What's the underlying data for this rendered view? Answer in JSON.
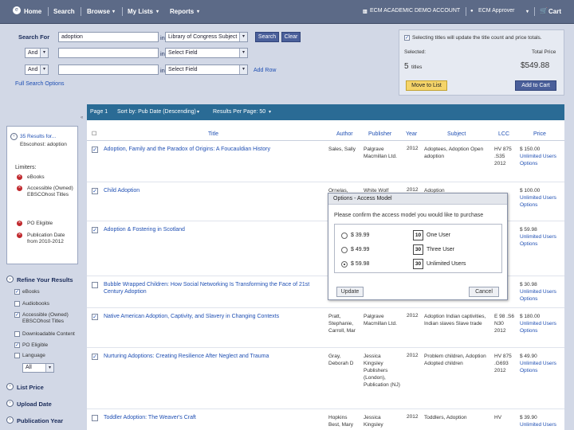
{
  "nav": {
    "home": "Home",
    "search": "Search",
    "browse": "Browse",
    "my_lists": "My Lists",
    "reports": "Reports",
    "account": "ECM ACADEMIC DEMO ACCOUNT",
    "approver": "ECM Approver",
    "cart": "Cart"
  },
  "search": {
    "search_for_label": "Search For",
    "query": "adoption",
    "in_label": "in",
    "field1": "Library of Congress Subject",
    "search_button": "Search",
    "clear_button": "Clear",
    "row2_op": "And",
    "row2_field": "Select Field",
    "row3_op": "And",
    "row3_field": "Select Field",
    "add_row": "Add Row",
    "full_search_options": "Full Search Options"
  },
  "selection": {
    "note": "Selecting titles will update the title count and price totals.",
    "selected_label": "Selected:",
    "total_price_label": "Total Price",
    "count": "5",
    "count_unit": "titles",
    "total_price": "$549.88",
    "move_to_list": "Move to List",
    "add_to_cart": "Add to Cart"
  },
  "results_bar": {
    "page": "Page 1",
    "sort": "Sort by: Pub Date (Descending)",
    "per_page": "Results Per Page: 50"
  },
  "columns": {
    "title": "Title",
    "author": "Author",
    "publisher": "Publisher",
    "year": "Year",
    "subject": "Subject",
    "lcc": "LCC",
    "price": "Price"
  },
  "sidebar": {
    "results_for": "35 Results for...",
    "results_for_sub": "Ebscohost: adoption",
    "limiters_label": "Limiters:",
    "limiters": [
      "eBooks",
      "Accessible (Owned) EBSCOhost Titles",
      "PO Eligible",
      "Publication Date from 2010-2012"
    ],
    "refine_label": "Refine Your Results",
    "refine": [
      {
        "label": "eBooks",
        "checked": true
      },
      {
        "label": "Audiobooks",
        "checked": false
      },
      {
        "label": "Accessible (Owned) EBSCOhost Titles",
        "checked": true
      },
      {
        "label": "Downloadable Content",
        "checked": false
      },
      {
        "label": "PO Eligible",
        "checked": true
      },
      {
        "label": "Language",
        "checked": false
      }
    ],
    "language_value": "All",
    "list_price": "List Price",
    "upload_date": "Upload Date",
    "publication_year": "Publication Year"
  },
  "rows": [
    {
      "title": "Adoption, Family and the Paradox of Origins: A Foucauldian History",
      "author": "Sales, Sally",
      "publisher": "Palgrave Macmillan Ltd.",
      "year": "2012",
      "subject": "Adoptees, Adoption Open adoption",
      "lcc": "HV 875 .S35 2012",
      "price": "$ 150.00",
      "license": "Unlimited Users",
      "options": "Options",
      "checked": true
    },
    {
      "title": "Child Adoption",
      "author": "Ornelas,",
      "publisher": "White Wolf",
      "year": "2012",
      "subject": "Adoption",
      "lcc": "",
      "price": "$ 100.00",
      "license": "Unlimited Users",
      "options": "Options",
      "checked": true
    },
    {
      "title": "Adoption & Fostering in Scotland",
      "author": "",
      "publisher": "",
      "year": "",
      "subject": "",
      "lcc": "",
      "price": "$ 59.98",
      "license": "Unlimited Users",
      "options": "Options",
      "checked": true
    },
    {
      "title": "Bubble Wrapped Children: How Social Networking Is Transforming the Face of 21st Century Adoption",
      "author": "",
      "publisher": "",
      "year": "",
      "subject": "",
      "lcc": "",
      "price": "$ 30.98",
      "license": "Unlimited Users",
      "options": "Options",
      "checked": false
    },
    {
      "title": "Native American Adoption, Captivity, and Slavery in Changing Contexts",
      "author": "Pratt, Stephanie, Carroll, Mar",
      "publisher": "Palgrave Macmillan Ltd.",
      "year": "2012",
      "subject": "Adoption Indian captivities, Indian slaves Slave trade",
      "lcc": "E 98 .S6 N30 2012",
      "price": "$ 180.00",
      "license": "Unlimited Users",
      "options": "Options",
      "checked": true
    },
    {
      "title": "Nurturing Adoptions: Creating Resilience After Neglect and Trauma",
      "author": "Gray, Deborah D",
      "publisher": "Jessica Kingsley Publishers (London), Publication (NJ)",
      "year": "2012",
      "subject": "Problem children, Adoption Adopted children",
      "lcc": "HV 875 .G693 2012",
      "price": "$ 49.90",
      "license": "Unlimited Users",
      "options": "Options",
      "checked": true
    },
    {
      "title": "Toddler Adoption: The Weaver's Craft",
      "author": "Hopkins Best, Mary",
      "publisher": "Jessica Kingsley",
      "year": "2012",
      "subject": "Toddlers, Adoption",
      "lcc": "HV",
      "price": "$ 39.90",
      "license": "Unlimited Users",
      "options": "",
      "checked": false
    }
  ],
  "modal": {
    "title": "Options - Access Model",
    "prompt": "Please confirm the access model you would like to purchase",
    "options": [
      {
        "price": "$ 39.99",
        "days": "10",
        "label": "One User",
        "selected": false
      },
      {
        "price": "$ 49.99",
        "days": "30",
        "label": "Three User",
        "selected": false
      },
      {
        "price": "$ 59.98",
        "days": "30",
        "label": "Unlimited Users",
        "selected": true
      }
    ],
    "update_button": "Update",
    "cancel_button": "Cancel"
  }
}
